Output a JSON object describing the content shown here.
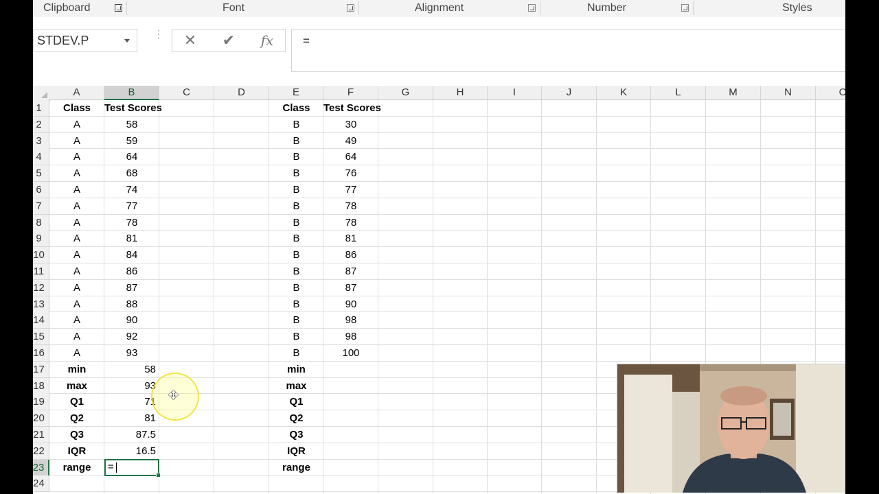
{
  "ribbon": {
    "groups": [
      "Clipboard",
      "Font",
      "Alignment",
      "Number",
      "Styles"
    ]
  },
  "formula_bar": {
    "name_box": "STDEV.P",
    "cancel_icon": "✕",
    "enter_icon": "✔",
    "fx_label": "fx",
    "formula": "="
  },
  "grid": {
    "columns": [
      "A",
      "B",
      "C",
      "D",
      "E",
      "F",
      "G",
      "H",
      "I",
      "J",
      "K",
      "L",
      "M",
      "N",
      "O"
    ],
    "rows": [
      "1",
      "2",
      "3",
      "4",
      "5",
      "6",
      "7",
      "8",
      "9",
      "10",
      "11",
      "12",
      "13",
      "14",
      "15",
      "16",
      "17",
      "18",
      "19",
      "20",
      "21",
      "22",
      "23",
      "24"
    ],
    "header": {
      "class": "Class",
      "scores": "Test Scores"
    },
    "class_a": {
      "label": "A",
      "scores": [
        "58",
        "59",
        "64",
        "68",
        "74",
        "77",
        "78",
        "81",
        "84",
        "86",
        "87",
        "88",
        "90",
        "92",
        "93"
      ]
    },
    "class_b": {
      "label": "B",
      "scores": [
        "30",
        "49",
        "64",
        "76",
        "77",
        "78",
        "78",
        "81",
        "86",
        "87",
        "87",
        "90",
        "98",
        "98",
        "100"
      ]
    },
    "stat_labels": [
      "min",
      "max",
      "Q1",
      "Q2",
      "Q3",
      "IQR",
      "range"
    ],
    "stats_a": [
      "58",
      "93",
      "71",
      "81",
      "87.5",
      "16.5"
    ],
    "active_cell_text": "="
  },
  "colors": {
    "accent": "#217346"
  },
  "icons": {
    "cursor": "move-cursor-icon"
  }
}
